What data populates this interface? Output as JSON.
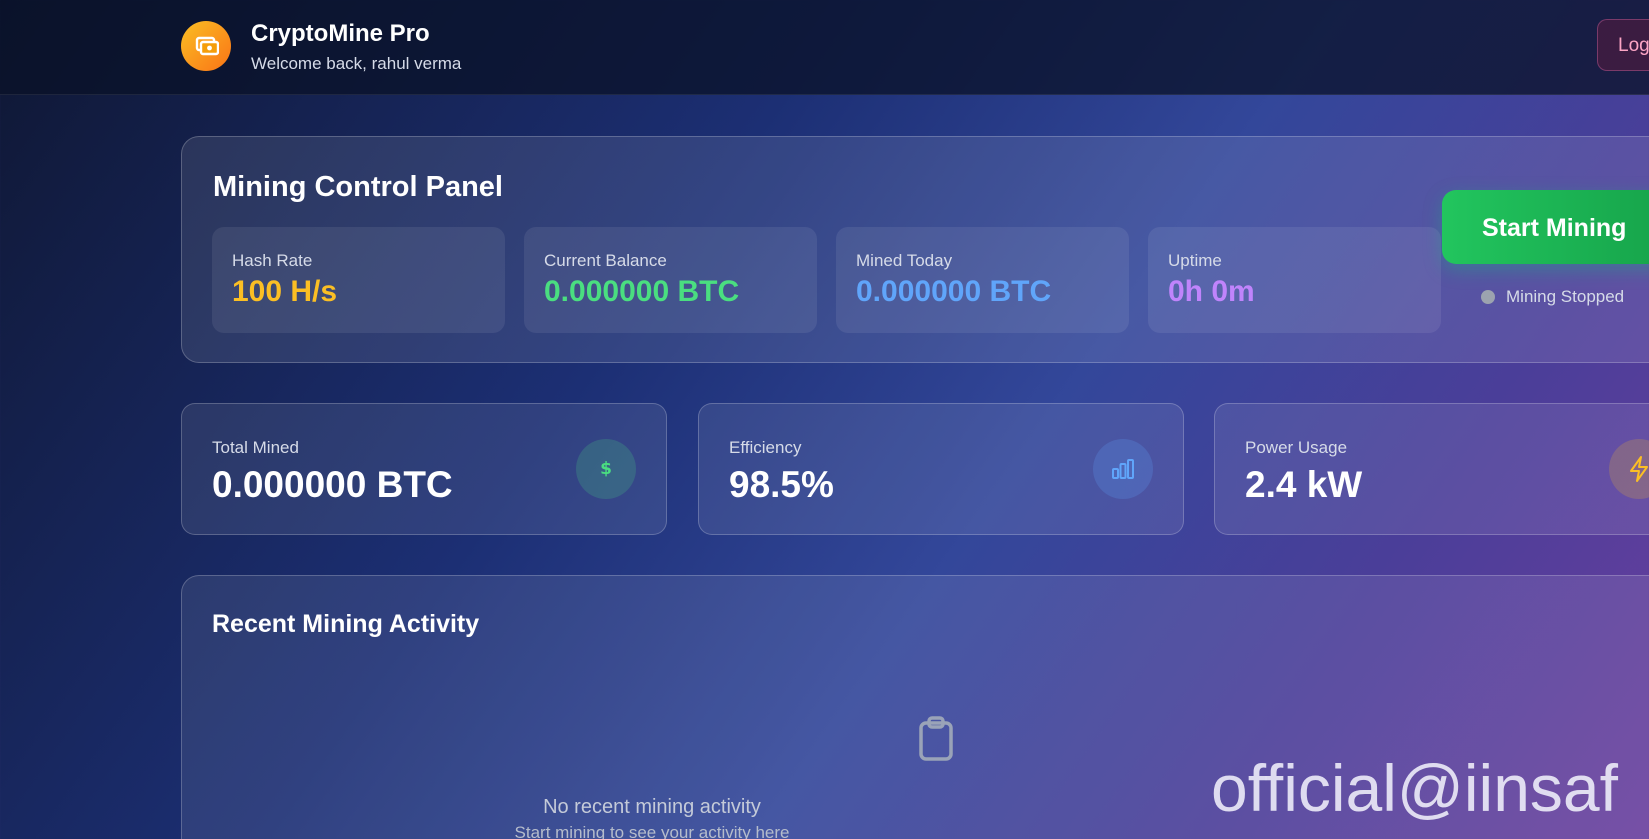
{
  "header": {
    "app_title": "CryptoMine Pro",
    "welcome": "Welcome back, rahul verma",
    "logout_label": "Log"
  },
  "control_panel": {
    "title": "Mining Control Panel",
    "stats": [
      {
        "label": "Hash Rate",
        "value": "100 H/s",
        "color": "#fbbf24"
      },
      {
        "label": "Current Balance",
        "value": "0.000000 BTC",
        "color": "#4ade80"
      },
      {
        "label": "Mined Today",
        "value": "0.000000 BTC",
        "color": "#60a5fa"
      },
      {
        "label": "Uptime",
        "value": "0h 0m",
        "color": "#c084fc"
      }
    ],
    "start_button": "Start Mining",
    "status": "Mining Stopped"
  },
  "summary_cards": [
    {
      "label": "Total Mined",
      "value": "0.000000 BTC",
      "icon": "dollar-icon",
      "icon_color": "#4ade80"
    },
    {
      "label": "Efficiency",
      "value": "98.5%",
      "icon": "bar-chart-icon",
      "icon_color": "#60a5fa"
    },
    {
      "label": "Power Usage",
      "value": "2.4 kW",
      "icon": "lightning-icon",
      "icon_color": "#fbbf24"
    }
  ],
  "activity": {
    "title": "Recent Mining Activity",
    "empty_message": "No recent mining activity",
    "empty_sub": "Start mining to see your activity here"
  },
  "watermark": "official@iinsaf"
}
